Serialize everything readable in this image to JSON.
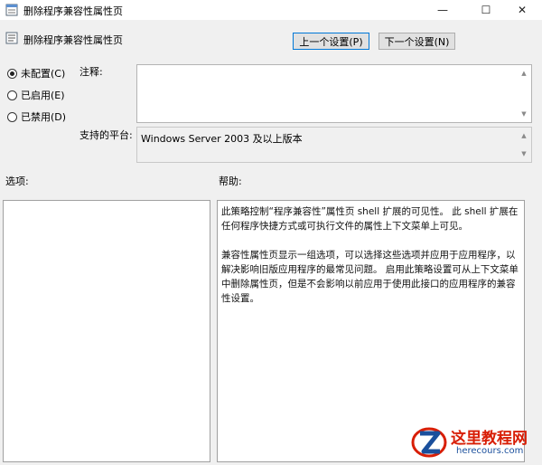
{
  "window": {
    "title": "删除程序兼容性属性页",
    "controls": {
      "minimize": "—",
      "maximize": "☐",
      "close": "✕"
    }
  },
  "header": {
    "title": "删除程序兼容性属性页",
    "prev_button": "上一个设置(P)",
    "next_button": "下一个设置(N)"
  },
  "state_options": [
    {
      "label": "未配置(C)",
      "checked": true
    },
    {
      "label": "已启用(E)",
      "checked": false
    },
    {
      "label": "已禁用(D)",
      "checked": false
    }
  ],
  "comment": {
    "label": "注释:",
    "value": ""
  },
  "platform": {
    "label": "支持的平台:",
    "value": "Windows Server 2003 及以上版本"
  },
  "options": {
    "label": "选项:"
  },
  "help": {
    "label": "帮助:",
    "paragraphs": [
      "此策略控制“程序兼容性”属性页 shell 扩展的可见性。 此 shell 扩展在任何程序快捷方式或可执行文件的属性上下文菜单上可见。",
      "兼容性属性页显示一组选项，可以选择这些选项并应用于应用程序，以解决影响旧版应用程序的最常见问题。 启用此策略设置可从上下文菜单中删除属性页，但是不会影响以前应用于使用此接口的应用程序的兼容性设置。"
    ]
  },
  "watermark": {
    "name": "这里教程网",
    "url": "herecours.com"
  },
  "colors": {
    "accent": "#0078d7",
    "window_bg": "#f0f0f0",
    "watermark_red": "#d81e06",
    "watermark_blue": "#1a4f9c"
  }
}
